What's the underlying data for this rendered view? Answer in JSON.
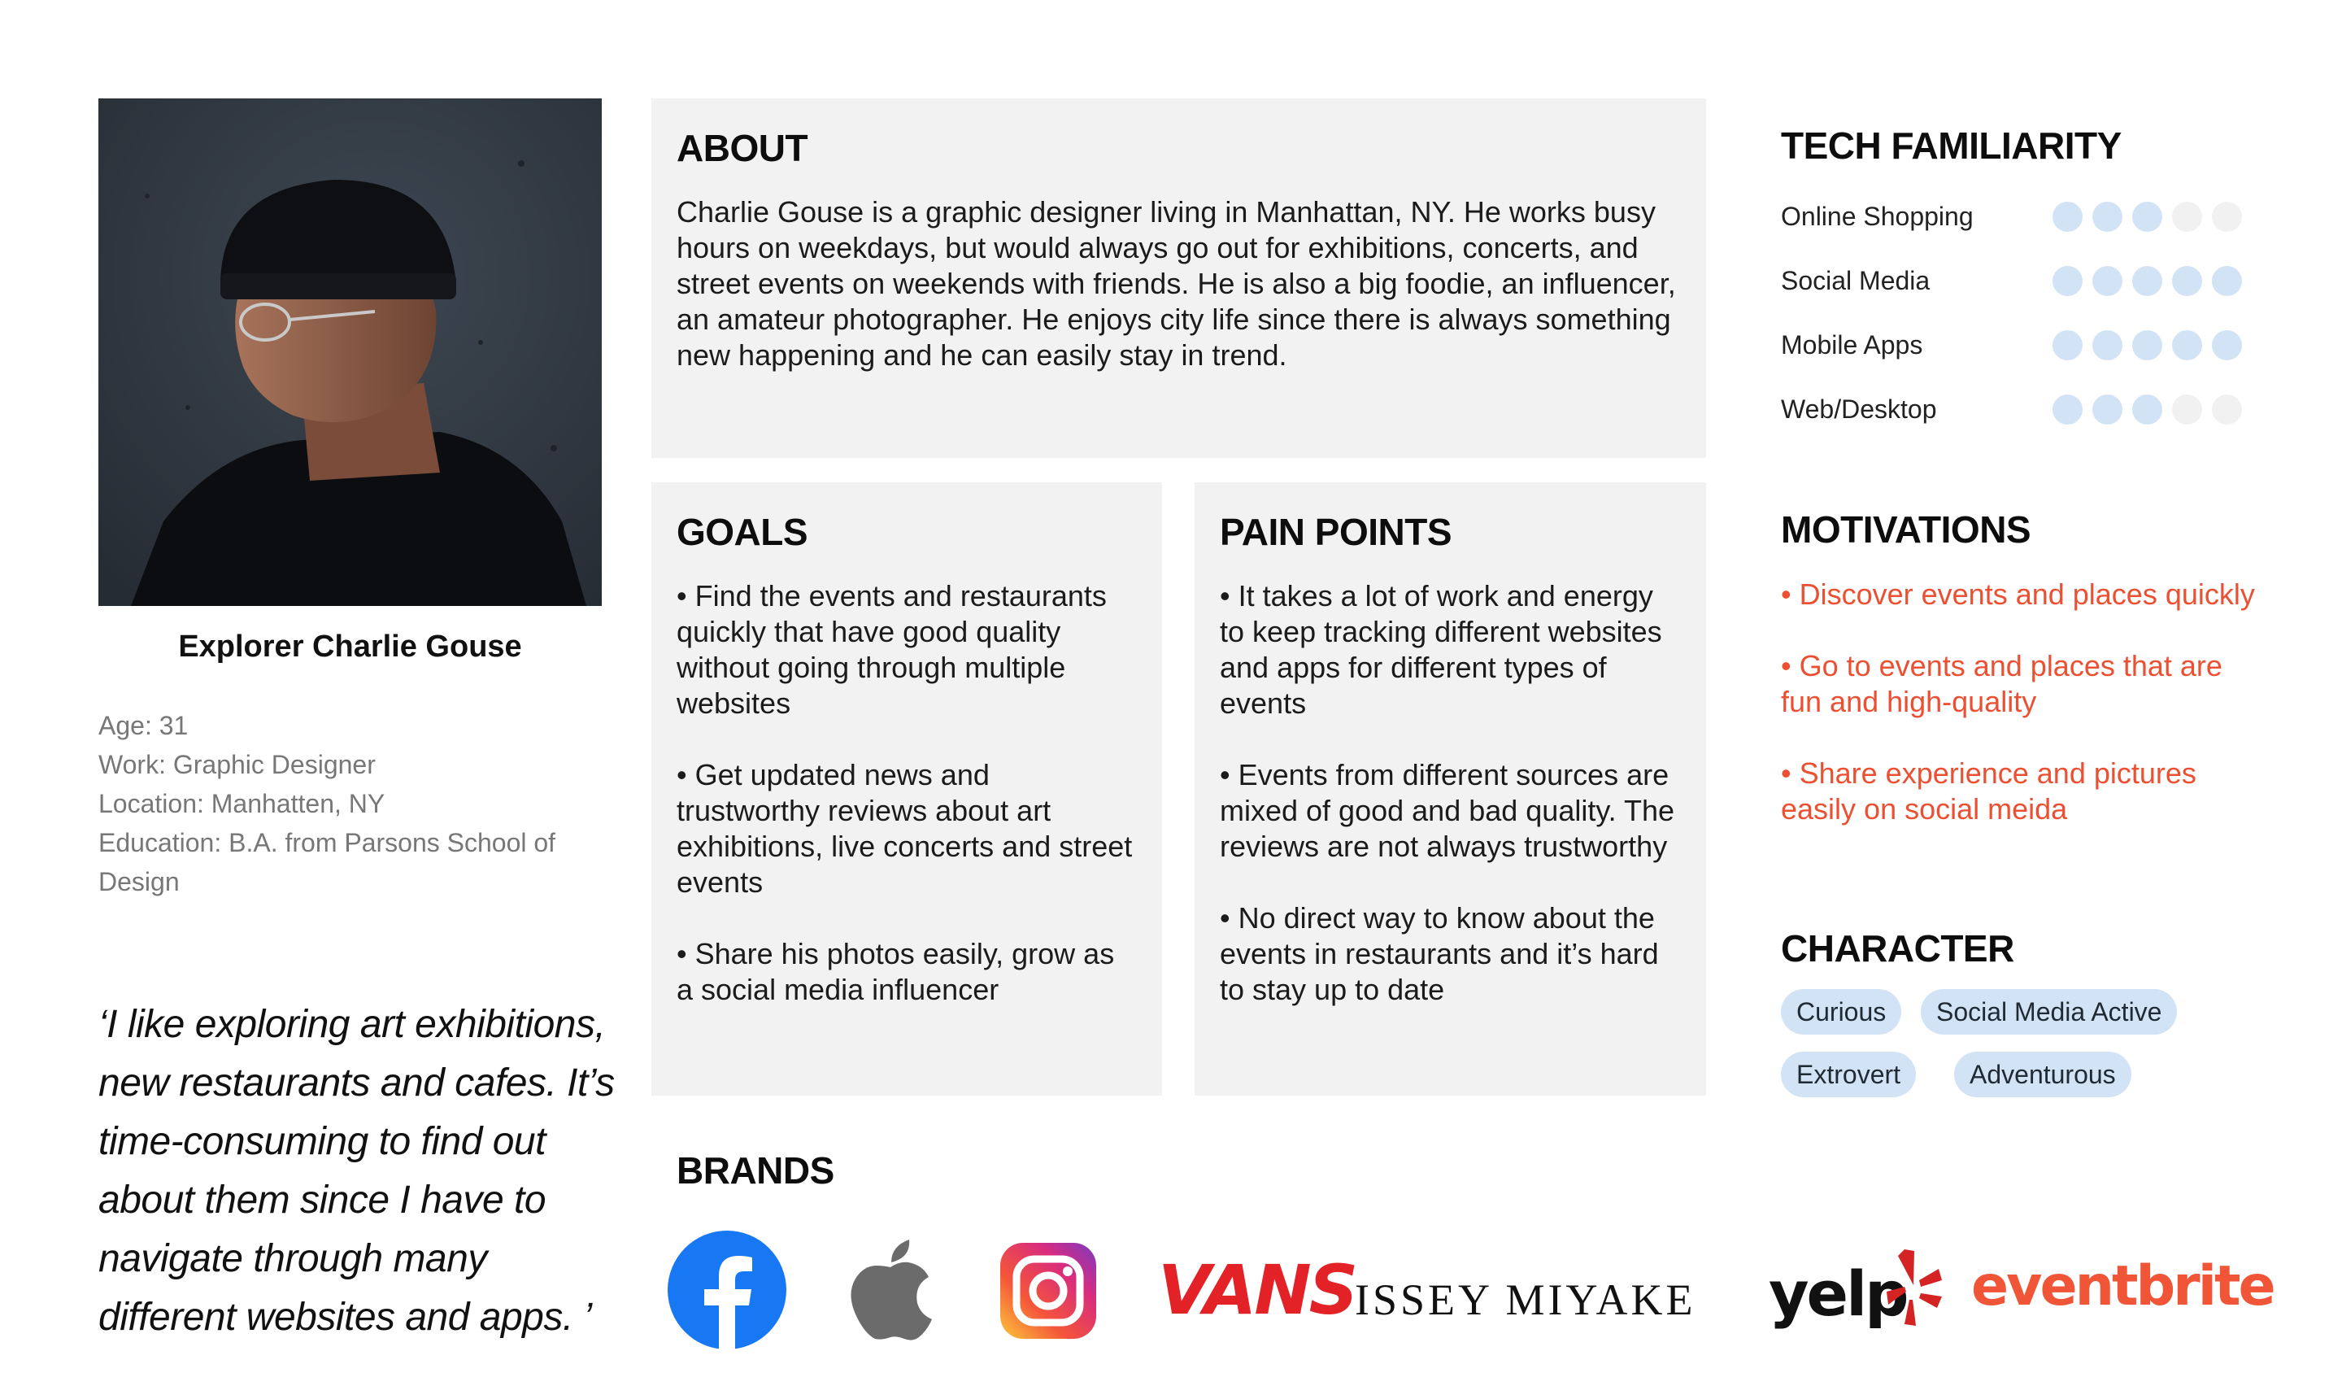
{
  "persona": {
    "name": "Explorer Charlie Gouse",
    "details": [
      "Age: 31",
      "Work: Graphic Designer",
      "Location: Manhatten, NY",
      "Education: B.A. from Parsons School of Design"
    ],
    "quote": "‘I like exploring art exhibitions, new restaurants and cafes. It’s time-consuming to find out about them since I have to navigate through many different websites and apps. ’"
  },
  "about": {
    "title": "ABOUT",
    "text": "Charlie Gouse is a graphic designer living in Manhattan, NY. He works busy hours on weekdays, but would always go out for exhibitions, concerts, and street events on weekends with friends. He is also a big foodie, an influencer, an amateur photographer. He enjoys city life since there is always something new happening and he can easily stay in trend."
  },
  "goals": {
    "title": "GOALS",
    "items": [
      "• Find the events and restaurants quickly that have good quality without going through multiple websites",
      "• Get updated news and trustworthy reviews about art exhibitions, live concerts and street events",
      "• Share his photos easily, grow as a social media influencer"
    ]
  },
  "pain_points": {
    "title": "PAIN POINTS",
    "items": [
      "• It takes a lot of work and energy to keep tracking different websites and apps for different types of events",
      "• Events from different sources are mixed of good and bad quality. The reviews are not always trustworthy",
      "• No direct way to know about the events in restaurants and it’s hard to stay up to date"
    ]
  },
  "tech_familiarity": {
    "title": "TECH FAMILIARITY",
    "max": 5,
    "rows": [
      {
        "label": "Online Shopping",
        "level": 3
      },
      {
        "label": "Social Media",
        "level": 5
      },
      {
        "label": "Mobile Apps",
        "level": 5
      },
      {
        "label": "Web/Desktop",
        "level": 3
      }
    ]
  },
  "motivations": {
    "title": "MOTIVATIONS",
    "items": [
      "• Discover events and places quickly",
      "• Go to events and places that are fun and high-quality",
      "• Share experience and pictures easily on social meida"
    ]
  },
  "character": {
    "title": "CHARACTER",
    "tags": [
      "Curious",
      "Social Media Active",
      "Extrovert",
      "Adventurous"
    ]
  },
  "brands": {
    "title": "BRANDS",
    "logos": [
      {
        "name": "facebook",
        "text": ""
      },
      {
        "name": "apple",
        "text": ""
      },
      {
        "name": "instagram",
        "text": ""
      },
      {
        "name": "vans",
        "text": "VANS"
      },
      {
        "name": "issey-miyake",
        "text": "ISSEY MIYAKE"
      },
      {
        "name": "yelp",
        "text": "yelp"
      },
      {
        "name": "eventbrite",
        "text": "eventbrite"
      }
    ]
  },
  "colors": {
    "panel": "#f2f2f2",
    "accent": "#ec5033",
    "tag": "#d3e3f6",
    "dot_on": "#d3e3f6",
    "dot_off": "#f1f1f1"
  }
}
